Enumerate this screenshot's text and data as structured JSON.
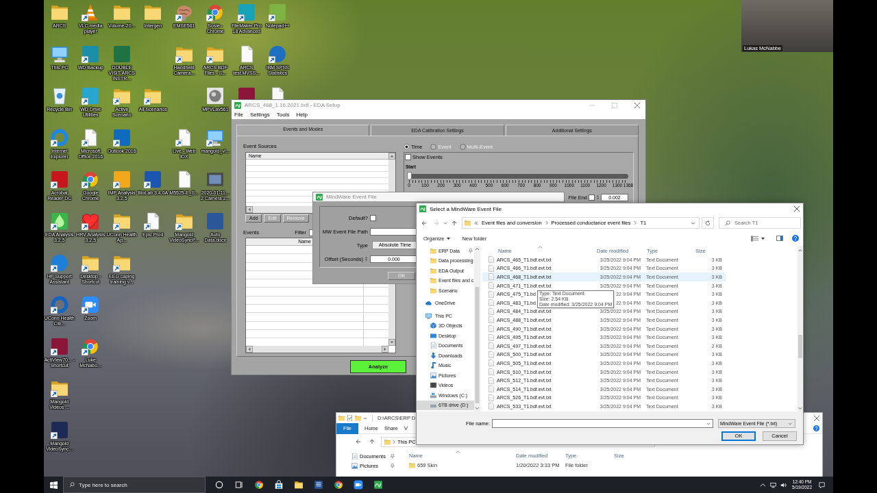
{
  "desktop": {
    "icons": [
      {
        "label": "ARCS",
        "shortcut": false
      },
      {
        "label": "This PC",
        "shortcut": false
      },
      {
        "label": "Recycle Bin",
        "shortcut": false
      },
      {
        "label": "Internet Explorer",
        "shortcut": true
      },
      {
        "label": "Acrobat Reader DC",
        "shortcut": true
      },
      {
        "label": "EDA Analysis 3.2.5",
        "shortcut": true
      },
      {
        "label": "HP Support Assistant",
        "shortcut": true
      },
      {
        "label": "UConn Health Citr...",
        "shortcut": true
      },
      {
        "label": "ActiView70... - Shortcut",
        "shortcut": true
      },
      {
        "label": "Mangold Videos ...",
        "shortcut": true
      },
      {
        "label": "Mangold VideoSync...",
        "shortcut": true
      },
      {
        "label": "VLC media player",
        "shortcut": true
      },
      {
        "label": "WD Backup",
        "shortcut": true
      },
      {
        "label": "WD Drive Utilities",
        "shortcut": true
      },
      {
        "label": "Microsoft Office 2016",
        "shortcut": true
      },
      {
        "label": "Google Chrome",
        "shortcut": true
      },
      {
        "label": "HRV Analysis 3.2.5",
        "shortcut": true
      },
      {
        "label": "Desktop - Shortcut",
        "shortcut": true
      },
      {
        "label": "Zoom",
        "shortcut": true
      },
      {
        "label": "Luke McNabo...",
        "shortcut": true
      },
      {
        "label": "Volume-20...",
        "shortcut": false
      },
      {
        "label": "DOUBLE VISIT ARCS INSTR...",
        "shortcut": false
      },
      {
        "label": "Active Scenario",
        "shortcut": true
      },
      {
        "label": "Outlook 2016",
        "shortcut": true
      },
      {
        "label": "IMP Analysis 3.2.5",
        "shortcut": true
      },
      {
        "label": "UConn Health Ap...",
        "shortcut": true
      },
      {
        "label": "EEG caping training v...",
        "shortcut": true
      },
      {
        "label": "Intergen",
        "shortcut": false
      },
      {
        "label": "All Scenarios",
        "shortcut": true
      },
      {
        "label": "BioLab 3.4.0A",
        "shortcut": true
      },
      {
        "label": "Epic Prod",
        "shortcut": true
      },
      {
        "label": "EMSE561",
        "shortcut": true
      },
      {
        "label": "Handheld Camera...",
        "shortcut": true
      },
      {
        "label": "Live - Web IDX",
        "shortcut": true
      },
      {
        "label": "M5525-E_S...",
        "shortcut": false
      },
      {
        "label": "Mangold VideoSyncP...",
        "shortcut": true
      },
      {
        "label": "Sosie - Chrome",
        "shortcut": true
      },
      {
        "label": "ARCS BDF Files - S...",
        "shortcut": true
      },
      {
        "label": "MPVLav561",
        "shortcut": false
      },
      {
        "label": "mangold_vi...",
        "shortcut": true
      },
      {
        "label": "2020-01-11... 2 Camera 2...",
        "shortcut": false
      },
      {
        "label": "Auto Data.docx",
        "shortcut": false
      },
      {
        "label": "FileMaker Pro 18 Advanced",
        "shortcut": true
      },
      {
        "label": "ARCS test.MVSS...",
        "shortcut": false
      },
      {
        "shortcut": false
      },
      {
        "label": "Notepad++",
        "shortcut": true
      },
      {
        "label": "IBM SPSS Statistics",
        "shortcut": true
      },
      {
        "shortcut": false
      }
    ]
  },
  "webcam": {
    "name": "Lukas McNabbe"
  },
  "eda_setup": {
    "title": "ARCS_468_1.16.2021.bdf - EDA Setup",
    "menu": [
      "File",
      "Settings",
      "Tools",
      "Help"
    ],
    "tabs": [
      {
        "label": "Events and Modes",
        "selected": true
      },
      {
        "label": "EDA Calibration Settings",
        "selected": false
      },
      {
        "label": "Additional Settings",
        "selected": false
      }
    ],
    "event_sources": {
      "label": "Event Sources",
      "column": "Name",
      "buttons": [
        {
          "label": "Add",
          "disabled": false
        },
        {
          "label": "Edit",
          "disabled": true
        },
        {
          "label": "Remove",
          "disabled": true
        }
      ]
    },
    "events": {
      "label": "Events",
      "filter_label": "Filter",
      "column": "Name"
    },
    "modes": [
      {
        "label": "Time",
        "selected": true,
        "disabled": false
      },
      {
        "label": "Event",
        "selected": false,
        "disabled": true
      },
      {
        "label": "Multi-Event",
        "selected": false,
        "disabled": true
      }
    ],
    "show_events": {
      "label": "Show Events",
      "checked": false
    },
    "start": {
      "label": "Start",
      "level": 0,
      "ticks": [
        "0",
        "100",
        "200",
        "300",
        "400",
        "500",
        "600",
        "700",
        "800",
        "900",
        "1000",
        "1100",
        "1200",
        "1300",
        "1368"
      ]
    },
    "file_end": {
      "label": "File End",
      "checked": false,
      "value": "0.002"
    },
    "analyze_button": "Analyze"
  },
  "event_file_dialog": {
    "title": "MindWare Event File",
    "default": {
      "label": "Default?",
      "checked": false
    },
    "path_label": "MW Event File Path",
    "type": {
      "label": "Type",
      "value": "Absolute Time"
    },
    "offset": {
      "label": "Offset (Seconds)",
      "value": "0.000"
    },
    "ok_button": {
      "label": "OK",
      "disabled": true
    }
  },
  "explorer": {
    "title": "D:\\ARCS\\ERP D",
    "ribbon_tabs": [
      {
        "label": "File",
        "kind": "file_menu"
      },
      {
        "label": "Home",
        "kind": "tab"
      },
      {
        "label": "Share",
        "kind": "tab"
      },
      {
        "label": "V",
        "kind": "tab"
      }
    ],
    "address": [
      "This PC"
    ],
    "nav": [
      {
        "label": "Documents",
        "pinned": true,
        "selected": false
      },
      {
        "label": "Pictures",
        "pinned": true,
        "selected": false
      }
    ],
    "columns": [
      "Name",
      "Date modified",
      "Type",
      "Size"
    ],
    "rows": [
      {
        "name": "659 Skin",
        "date": "1/20/2022 3:33 PM",
        "type": "File folder",
        "selected": false
      }
    ]
  },
  "open_dialog": {
    "title": "Select a MindWare Event File",
    "breadcrumb": [
      "Event files and conversion",
      "Processed conductance event files",
      "T1"
    ],
    "search_placeholder": "Search T1",
    "organize": "Organize",
    "new_folder": "New folder",
    "quick_access": [
      {
        "label": "ERP Data",
        "pinned": true,
        "selected": false
      },
      {
        "label": "Data processing",
        "pinned": false,
        "selected": false
      },
      {
        "label": "EDA Output",
        "pinned": false,
        "selected": false
      },
      {
        "label": "Event files and c",
        "pinned": false,
        "selected": false
      },
      {
        "label": "Scenario",
        "pinned": false,
        "selected": false
      }
    ],
    "places": [
      {
        "label": "OneDrive",
        "selected": false
      },
      {
        "label": "This PC",
        "selected": false,
        "children": [
          {
            "label": "3D Objects",
            "selected": false
          },
          {
            "label": "Desktop",
            "selected": false
          },
          {
            "label": "Documents",
            "selected": false
          },
          {
            "label": "Downloads",
            "selected": false
          },
          {
            "label": "Music",
            "selected": false
          },
          {
            "label": "Pictures",
            "selected": false
          },
          {
            "label": "Videos",
            "selected": false
          },
          {
            "label": "Windows (C:)",
            "selected": false
          },
          {
            "label": "6TB drive (D:)",
            "selected": true
          }
        ]
      }
    ],
    "columns": [
      "Name",
      "Date modified",
      "Type",
      "Size"
    ],
    "files": [
      {
        "name": "ARCS_465_T1.bdf.evt.txt",
        "date": "3/25/2022 9:04 PM",
        "type": "Text Document",
        "size": "3 KB",
        "hovered": false,
        "selected": false
      },
      {
        "name": "ARCS_466_T1.bdf.evt.txt",
        "date": "3/25/2022 9:04 PM",
        "type": "Text Document",
        "size": "3 KB",
        "hovered": false,
        "selected": false
      },
      {
        "name": "ARCS_468_T1.bdf.evt.txt",
        "date": "3/25/2022 9:04 PM",
        "type": "Text Document",
        "size": "3 KB",
        "hovered": true,
        "selected": false
      },
      {
        "name": "ARCS_471_T1.bdf.evt.txt",
        "date": "3/25/2022 9:04 PM",
        "type": "Text Document",
        "size": "3 KB",
        "hovered": false,
        "selected": false
      },
      {
        "name": "ARCS_475_T1.bd",
        "date": "22 9:04 PM",
        "type": "Text Document",
        "size": "3 KB",
        "hovered": false,
        "selected": false
      },
      {
        "name": "ARCS_483_T1.bd",
        "date": "22 9:04 PM",
        "type": "Text Document",
        "size": "3 KB",
        "hovered": false,
        "selected": false
      },
      {
        "name": "ARCS_484_T1.bdf.evt.txt",
        "date": "3/25/2022 9:04 PM",
        "type": "Text Document",
        "size": "3 KB",
        "hovered": false,
        "selected": false
      },
      {
        "name": "ARCS_488_T1.bdf.evt.txt",
        "date": "3/25/2022 9:04 PM",
        "type": "Text Document",
        "size": "3 KB",
        "hovered": false,
        "selected": false
      },
      {
        "name": "ARCS_490_T1.bdf.evt.txt",
        "date": "3/25/2022 9:04 PM",
        "type": "Text Document",
        "size": "3 KB",
        "hovered": false,
        "selected": false
      },
      {
        "name": "ARCS_495_T1.bdf.evt.txt",
        "date": "3/25/2022 9:04 PM",
        "type": "Text Document",
        "size": "3 KB",
        "hovered": false,
        "selected": false
      },
      {
        "name": "ARCS_497_T1.bdf.evt.txt",
        "date": "3/25/2022 9:04 PM",
        "type": "Text Document",
        "size": "2 KB",
        "hovered": false,
        "selected": false
      },
      {
        "name": "ARCS_500_T1.bdf.evt.txt",
        "date": "3/25/2022 9:04 PM",
        "type": "Text Document",
        "size": "3 KB",
        "hovered": false,
        "selected": false
      },
      {
        "name": "ARCS_505_T1.bdf.evt.txt",
        "date": "3/25/2022 9:04 PM",
        "type": "Text Document",
        "size": "3 KB",
        "hovered": false,
        "selected": false
      },
      {
        "name": "ARCS_510_T1.bdf.evt.txt",
        "date": "3/25/2022 9:04 PM",
        "type": "Text Document",
        "size": "3 KB",
        "hovered": false,
        "selected": false
      },
      {
        "name": "ARCS_512_T1.bdf.evt.txt",
        "date": "3/25/2022 9:04 PM",
        "type": "Text Document",
        "size": "3 KB",
        "hovered": false,
        "selected": false
      },
      {
        "name": "ARCS_514_T1.bdf.evt.txt",
        "date": "3/25/2022 9:04 PM",
        "type": "Text Document",
        "size": "3 KB",
        "hovered": false,
        "selected": false
      },
      {
        "name": "ARCS_526_T1.bdf.evt.txt",
        "date": "3/25/2022 9:04 PM",
        "type": "Text Document",
        "size": "3 KB",
        "hovered": false,
        "selected": false
      },
      {
        "name": "ARCS_533_T1.bdf.evt.txt",
        "date": "3/25/2022 9:04 PM",
        "type": "Text Document",
        "size": "3 KB",
        "hovered": false,
        "selected": false
      }
    ],
    "tooltip": [
      "Type: Text Document",
      "Size: 2.54 KB",
      "Date modified: 3/25/2022 9:04 PM"
    ],
    "file_name_label": "File name:",
    "filter": "MindWare Event File (*.txt)",
    "ok_button": "OK",
    "cancel_button": "Cancel"
  },
  "taskbar": {
    "search_placeholder": "Type here to search",
    "time": "12:40 PM",
    "date": "5/19/2022"
  }
}
